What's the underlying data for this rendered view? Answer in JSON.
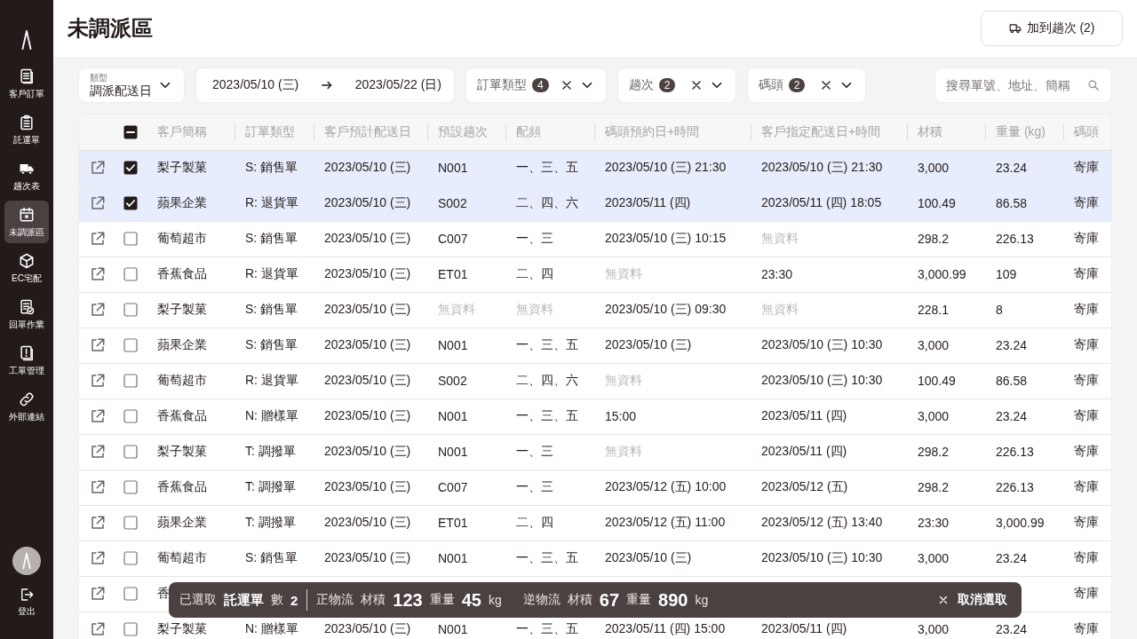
{
  "page_title": "未調派區",
  "add_button": {
    "label": "加到趟次 (2)"
  },
  "sidebar": {
    "items": [
      {
        "label": "客戶訂單",
        "selected": false
      },
      {
        "label": "託運單",
        "selected": false
      },
      {
        "label": "趟次表",
        "selected": false
      },
      {
        "label": "未調派區",
        "selected": true
      },
      {
        "label": "EC宅配",
        "selected": false
      },
      {
        "label": "回單作業",
        "selected": false
      },
      {
        "label": "工單管理",
        "selected": false
      },
      {
        "label": "外部連結",
        "selected": false
      }
    ],
    "logout": "登出"
  },
  "filters": {
    "type_select": {
      "label": "類型",
      "value": "調派配送日"
    },
    "date_range": {
      "start": "2023/05/10 (三)",
      "end": "2023/05/22 (日)"
    },
    "chips": [
      {
        "label": "訂單類型",
        "count": "4"
      },
      {
        "label": "趟次",
        "count": "2"
      },
      {
        "label": "碼頭",
        "count": "2"
      }
    ],
    "search": {
      "placeholder": "搜尋單號、地址、簡稱"
    }
  },
  "table": {
    "select_all": {
      "indeterminate": true
    },
    "columns": [
      "客戶簡稱",
      "訂單類型",
      "客戶預計配送日",
      "預設趟次",
      "配頻",
      "碼頭預約日+時間",
      "客戶指定配送日+時間",
      "材積",
      "重量 (kg)",
      "碼頭"
    ],
    "rows": [
      {
        "selected": true,
        "cells": [
          "梨子製菓",
          "S: 銷售單",
          "2023/05/10 (三)",
          "N001",
          "一、三、五",
          "2023/05/10 (三) 21:30",
          "2023/05/10 (三) 21:30",
          "3,000",
          "23.24",
          "寄庫"
        ]
      },
      {
        "selected": true,
        "cells": [
          "蘋果企業",
          "R: 退貨單",
          "2023/05/10 (三)",
          "S002",
          "二、四、六",
          "2023/05/11 (四)",
          "2023/05/11 (四) 18:05",
          "100.49",
          "86.58",
          "寄庫"
        ]
      },
      {
        "selected": false,
        "cells": [
          "葡萄超市",
          "S: 銷售單",
          "2023/05/10 (三)",
          "C007",
          "一、三",
          "2023/05/10 (三) 10:15",
          {
            "text": "無資料",
            "muted": true
          },
          "298.2",
          "226.13",
          "寄庫"
        ]
      },
      {
        "selected": false,
        "cells": [
          "香蕉食品",
          "R: 退貨單",
          "2023/05/10 (三)",
          "ET01",
          "二、四",
          {
            "text": "無資料",
            "muted": true
          },
          "23:30",
          "3,000.99",
          "109",
          "寄庫"
        ]
      },
      {
        "selected": false,
        "cells": [
          "梨子製菓",
          "S: 銷售單",
          "2023/05/10 (三)",
          {
            "text": "無資料",
            "muted": true
          },
          {
            "text": "無資料",
            "muted": true
          },
          "2023/05/10 (三) 09:30",
          {
            "text": "無資料",
            "muted": true
          },
          "228.1",
          "8",
          "寄庫"
        ]
      },
      {
        "selected": false,
        "cells": [
          "蘋果企業",
          "S: 銷售單",
          "2023/05/10 (三)",
          "N001",
          "一、三、五",
          "2023/05/10 (三)",
          "2023/05/10 (三) 10:30",
          "3,000",
          "23.24",
          "寄庫"
        ]
      },
      {
        "selected": false,
        "cells": [
          "葡萄超市",
          "R: 退貨單",
          "2023/05/10 (三)",
          "S002",
          "二、四、六",
          {
            "text": "無資料",
            "muted": true
          },
          "2023/05/10 (三) 10:30",
          "100.49",
          "86.58",
          "寄庫"
        ]
      },
      {
        "selected": false,
        "cells": [
          "香蕉食品",
          "N: 贈樣單",
          "2023/05/10 (三)",
          "N001",
          "一、三、五",
          "15:00",
          "2023/05/11 (四)",
          "3,000",
          "23.24",
          "寄庫"
        ]
      },
      {
        "selected": false,
        "cells": [
          "梨子製菓",
          "T: 調撥單",
          "2023/05/10 (三)",
          "N001",
          "一、三",
          {
            "text": "無資料",
            "muted": true
          },
          "2023/05/11 (四)",
          "298.2",
          "226.13",
          "寄庫"
        ]
      },
      {
        "selected": false,
        "cells": [
          "香蕉食品",
          "T: 調撥單",
          "2023/05/10 (三)",
          "C007",
          "一、三",
          "2023/05/12 (五) 10:00",
          "2023/05/12 (五)",
          "298.2",
          "226.13",
          "寄庫"
        ]
      },
      {
        "selected": false,
        "cells": [
          "蘋果企業",
          "T: 調撥單",
          "2023/05/10 (三)",
          "ET01",
          "二、四",
          "2023/05/12 (五) 11:00",
          "2023/05/12 (五) 13:40",
          "23:30",
          "3,000.99",
          "寄庫"
        ]
      },
      {
        "selected": false,
        "cells": [
          "葡萄超市",
          "S: 銷售單",
          "2023/05/10 (三)",
          "N001",
          "一、三、五",
          "2023/05/10 (三)",
          "2023/05/10 (三) 10:30",
          "3,000",
          "23.24",
          "寄庫"
        ]
      },
      {
        "selected": false,
        "cells": [
          "香",
          null,
          null,
          null,
          null,
          null,
          null,
          null,
          null,
          "寄庫"
        ]
      },
      {
        "selected": false,
        "cells": [
          "梨子製菓",
          "N: 贈樣單",
          "2023/05/10 (三)",
          "N001",
          "一、三、五",
          "2023/05/11 (四) 15:00",
          "2023/05/11 (四)",
          "3,000",
          "23.24",
          "寄庫"
        ]
      }
    ]
  },
  "selection_bar": {
    "label": "已選取",
    "doc_type": "託運單",
    "count_label": "數",
    "count": "2",
    "groups": [
      {
        "label": "正物流",
        "metrics": [
          {
            "label": "材積",
            "value": "123"
          },
          {
            "label": "重量",
            "value": "45",
            "unit": "kg"
          }
        ]
      },
      {
        "label": "逆物流",
        "metrics": [
          {
            "label": "材積",
            "value": "67"
          },
          {
            "label": "重量",
            "value": "890",
            "unit": "kg"
          }
        ]
      }
    ],
    "cancel": "取消選取"
  }
}
